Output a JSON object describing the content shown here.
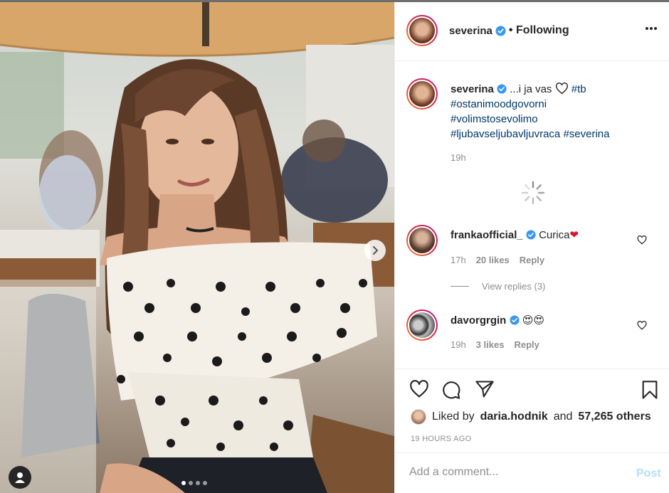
{
  "post": {
    "author": "severina",
    "follow_state": "• Following",
    "more_icon": "more-horizontal-icon",
    "caption": {
      "text": "...i ja vas",
      "heart": "heart-outline-icon",
      "tags": [
        "#tb",
        "#ostanimoodgovorni",
        "#volimstosevolimo",
        "#ljubavseljubavljuvraca",
        "#severina"
      ],
      "time": "19h"
    },
    "carousel": {
      "slides": 4,
      "active": 0
    }
  },
  "comments": [
    {
      "user": "frankaofficial_",
      "verified": true,
      "text": "Curica",
      "emoji": "❤",
      "time": "17h",
      "likes": "20 likes",
      "reply": "Reply",
      "view_replies": "View replies (3)"
    },
    {
      "user": "davorgrgin",
      "verified": true,
      "text": "😍😍",
      "time": "19h",
      "likes": "3 likes",
      "reply": "Reply"
    }
  ],
  "likes": {
    "prefix": "Liked by",
    "user": "daria.hodnik",
    "conj": "and",
    "others": "57,265 others"
  },
  "post_age": "19 HOURS AGO",
  "add_comment": {
    "placeholder": "Add a comment...",
    "post_label": "Post"
  },
  "colors": {
    "link": "#00376b",
    "verified": "#3897f0",
    "post_disabled": "#b2dffc",
    "muted": "#8e8e8e"
  }
}
